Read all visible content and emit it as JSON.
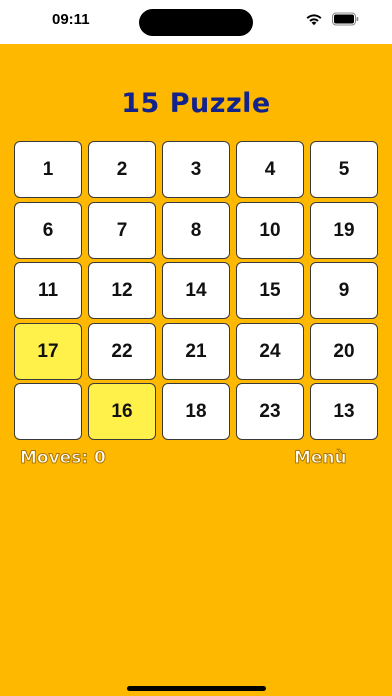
{
  "status_bar": {
    "time": "09:11"
  },
  "title": "15 Puzzle",
  "board": {
    "rows": 5,
    "cols": 5,
    "tiles": [
      [
        "1",
        "2",
        "3",
        "4",
        "5"
      ],
      [
        "6",
        "7",
        "8",
        "10",
        "19"
      ],
      [
        "11",
        "12",
        "14",
        "15",
        "9"
      ],
      [
        "17",
        "22",
        "21",
        "24",
        "20"
      ],
      [
        "",
        "16",
        "18",
        "23",
        "13"
      ]
    ],
    "highlighted": [
      "17",
      "16"
    ],
    "empty_cell": {
      "row": 5,
      "col": 1
    }
  },
  "moves_label": "Moves: 0",
  "menu_label": "Menù",
  "colors": {
    "background": "#ffb800",
    "title": "#12238c",
    "tile": "#ffffff",
    "tile_highlight": "#fff04a",
    "tile_border": "#3a3a3a"
  }
}
